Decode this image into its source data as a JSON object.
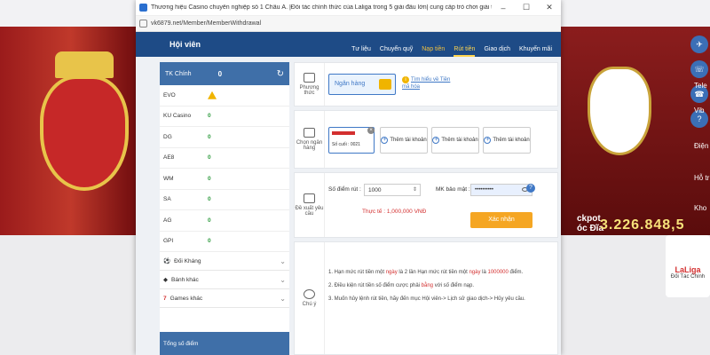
{
  "window": {
    "title": "Thương hiệu Casino chuyên nghiệp số 1 Châu Á. |Đối tác chính thức của Laliga trong 5 giải đấu lớn| cung cấp trò chơi giải trí (Thể Thao, Casino, E-Sports...",
    "url": "vk6879.net/Member/MemberWithdrawal",
    "controls": [
      "–",
      "☐",
      "✕"
    ]
  },
  "nav": {
    "brand": "Hội viên",
    "items": [
      {
        "label": "Tư liệu",
        "state": "normal"
      },
      {
        "label": "Chuyển quỹ",
        "state": "normal"
      },
      {
        "label": "Nạp tiền",
        "state": "active"
      },
      {
        "label": "Rút tiền",
        "state": "current"
      },
      {
        "label": "Giao dịch",
        "state": "normal"
      },
      {
        "label": "Khuyến mãi",
        "state": "normal"
      }
    ]
  },
  "sidebar": {
    "account_label": "TK Chính",
    "account_balance": "0",
    "rows": [
      {
        "name": "EVO",
        "value": "",
        "warning": true
      },
      {
        "name": "KU Casino",
        "value": "0"
      },
      {
        "name": "DG",
        "value": "0"
      },
      {
        "name": "AE8",
        "value": "0"
      },
      {
        "name": "WM",
        "value": "0"
      },
      {
        "name": "SA",
        "value": "0"
      },
      {
        "name": "AG",
        "value": "0"
      },
      {
        "name": "GPI",
        "value": "0"
      }
    ],
    "groups": [
      {
        "label": "Đối Kháng",
        "icon": "sports-icon"
      },
      {
        "label": "Bánh khác",
        "icon": "diamond-icon"
      },
      {
        "label": "Games khác",
        "icon": "seven-icon"
      }
    ],
    "total_label": "Tổng số điểm"
  },
  "method": {
    "label": "Phương thức",
    "option": "Ngân hàng",
    "tip": "Tìm hiểu về Tiền mã hóa"
  },
  "bank": {
    "label": "Chọn ngân hàng",
    "card_tail": "Số cuối : 0021",
    "add_label": "Thêm tài khoản"
  },
  "request": {
    "label": "Đề xuất yêu cầu",
    "points_label": "Số điểm rút :",
    "points_value": "1000",
    "password_label": "MK bảo mật :",
    "password_value": "••••••••••",
    "actual_label": "Thực tế :",
    "actual_value": "1,000,000 VNĐ",
    "confirm": "Xác nhận"
  },
  "notes": {
    "label": "Chú ý",
    "n1a": "Hạn mức rút tiền một",
    "n1b": "ngày",
    "n1c": "là 2 lần Hạn mức rút tiền một",
    "n1d": "ngày",
    "n1e": "là",
    "n1f": "1000000",
    "n1g": "điểm.",
    "n2a": "Điều kiện rút tiền số điểm cược phải",
    "n2b": "bằng",
    "n2c": "với số điểm nạp.",
    "n3": "Muốn hủy lệnh rút tiền, hãy đến mục Hội viên-> Lịch sử giao dịch-> Hủy yêu cầu."
  },
  "background": {
    "jackpot_label": "ckpot",
    "jackpot_sub": "óc Đĩa",
    "jackpot_value": "3.226.848,5",
    "side_labels": [
      "Tele",
      "Vib",
      "Điện",
      "Hỗ tr",
      "Kho"
    ],
    "laliga": "LaLiga",
    "laliga_sub": "Đối Tác Chính"
  },
  "colors": {
    "nav_bg": "#1e4b86",
    "accent": "#3f78c6",
    "confirm": "#f5a623",
    "highlight": "#d32f2f"
  }
}
